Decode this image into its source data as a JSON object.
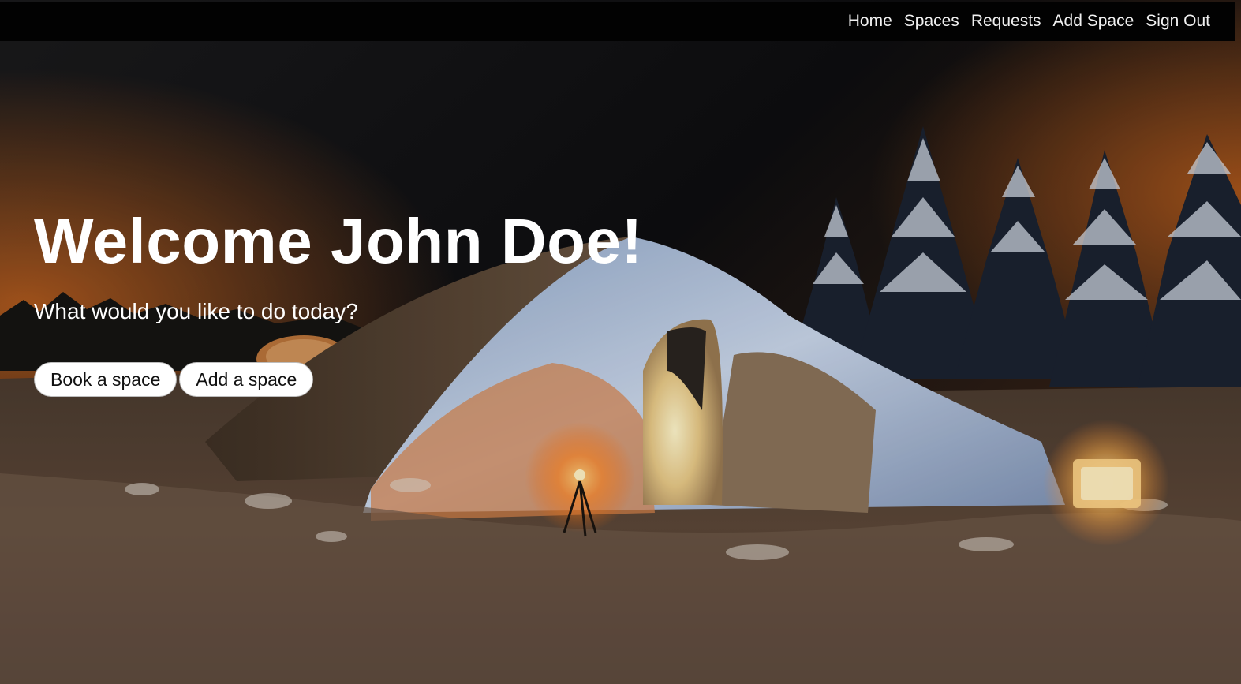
{
  "nav": {
    "items": [
      {
        "label": "Home"
      },
      {
        "label": "Spaces"
      },
      {
        "label": "Requests"
      },
      {
        "label": "Add Space"
      },
      {
        "label": "Sign Out"
      }
    ]
  },
  "hero": {
    "title": "Welcome John Doe!",
    "subtitle": "What would you like to do today?",
    "buttons": {
      "book_label": "Book a space",
      "add_label": "Add a space"
    },
    "background_image": "night-igloo-snow-scene"
  },
  "colors": {
    "navbar_bg": "#020202",
    "nav_text": "#f1f1f1",
    "title_text": "#ffffff",
    "button_bg": "#ffffff"
  }
}
